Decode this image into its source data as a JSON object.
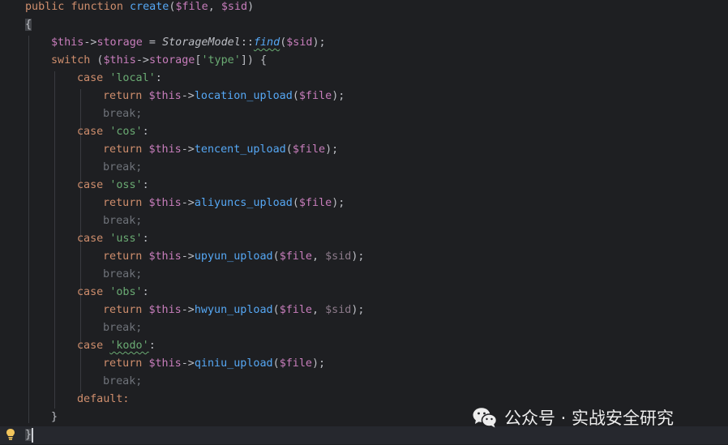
{
  "code": {
    "line1": {
      "public": "public",
      "function": "function",
      "name": "create",
      "p1": "$file",
      "p2": "$sid"
    },
    "open_brace": "{",
    "storage_line": {
      "this": "$this",
      "arrow": "->",
      "prop": "storage",
      "eq": " = ",
      "cls": "StorageModel",
      "sep": "::",
      "find": "find",
      "arg": "$sid"
    },
    "switch_line": {
      "kw": "switch",
      "this": "$this",
      "prop": "storage",
      "key": "'type'"
    },
    "cases": [
      {
        "label": "'local'",
        "method": "location_upload",
        "args": "$file",
        "extra": ""
      },
      {
        "label": "'cos'",
        "method": "tencent_upload",
        "args": "$file",
        "extra": ""
      },
      {
        "label": "'oss'",
        "method": "aliyuncs_upload",
        "args": "$file",
        "extra": ""
      },
      {
        "label": "'uss'",
        "method": "upyun_upload",
        "args": "$file",
        "extra": "$sid"
      },
      {
        "label": "'obs'",
        "method": "hwyun_upload",
        "args": "$file",
        "extra": "$sid"
      },
      {
        "label": "'kodo'",
        "method": "qiniu_upload",
        "args": "$file",
        "extra": ""
      }
    ],
    "kw_case": "case",
    "kw_return": "return",
    "kw_break": "break;",
    "kw_default": "default:",
    "close_inner": "}",
    "close_outer": "}"
  },
  "watermark": {
    "text": "公众号 · 实战安全研究"
  },
  "icons": {
    "bulb": "lightbulb-icon",
    "wechat": "wechat-icon"
  }
}
